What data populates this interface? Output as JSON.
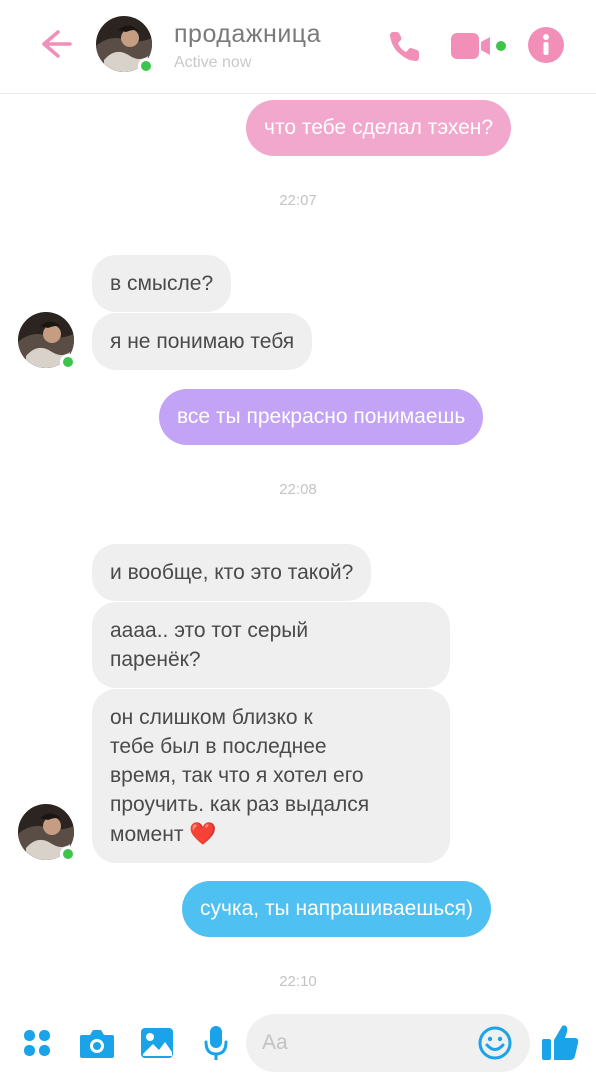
{
  "header": {
    "contact_name": "продажница",
    "status": "Active now"
  },
  "messages": [
    {
      "type": "out",
      "text": "что тебе сделал тэхен?"
    },
    {
      "type": "time",
      "text": "22:07"
    },
    {
      "type": "in",
      "text": "в смысле?"
    },
    {
      "type": "in",
      "text": "я не понимаю тебя"
    },
    {
      "type": "out",
      "text": "все ты прекрасно понимаешь"
    },
    {
      "type": "time",
      "text": "22:08"
    },
    {
      "type": "in",
      "text": "и вообще, кто это такой?"
    },
    {
      "type": "in",
      "lines": [
        "аааа.. это тот серый",
        "паренёк?"
      ]
    },
    {
      "type": "in",
      "lines": [
        "он слишком близко к",
        "тебе был в последнее",
        "время, так что я хотел его",
        "проучить. как раз выдался",
        "момент"
      ],
      "emoji": "❤️"
    },
    {
      "type": "out",
      "text": "сучка, ты напрашиваешься)"
    },
    {
      "type": "time",
      "text": "22:10"
    }
  ],
  "composer": {
    "placeholder": "Aa"
  },
  "colors": {
    "accent_pink": "#f18fb8",
    "accent_blue": "#1aa3e8",
    "online": "#3cc54a",
    "bubble_pink": "#f2a7cc",
    "bubble_purple": "#c3a3f5",
    "bubble_blue": "#4fc0f2",
    "bubble_incoming": "#efefef"
  },
  "icons": [
    "back-arrow-icon",
    "phone-icon",
    "video-camera-icon",
    "info-icon",
    "apps-icon",
    "camera-icon",
    "gallery-icon",
    "microphone-icon",
    "emoji-icon",
    "thumbs-up-icon"
  ]
}
